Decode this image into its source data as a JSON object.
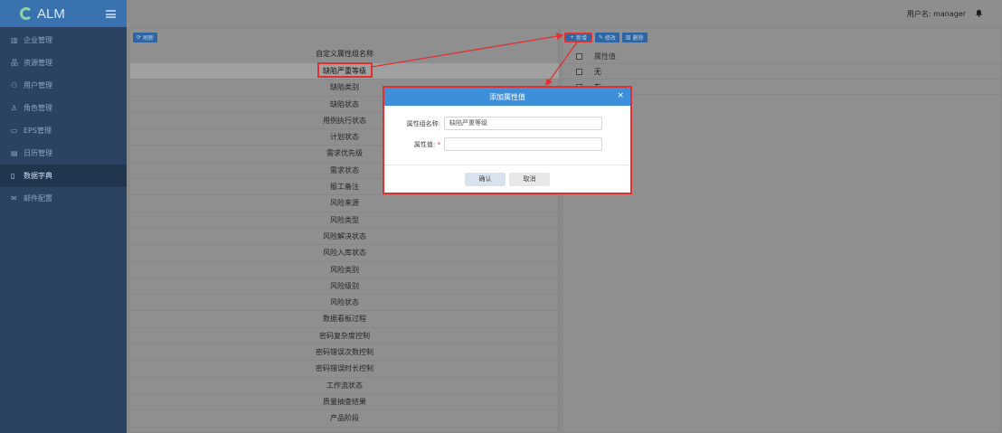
{
  "brand": {
    "logo_text": "ALM"
  },
  "sidebar": {
    "items": [
      {
        "label": "企业管理",
        "icon": "building-icon"
      },
      {
        "label": "资源管理",
        "icon": "sitemap-icon"
      },
      {
        "label": "用户管理",
        "icon": "users-icon"
      },
      {
        "label": "角色管理",
        "icon": "role-icon"
      },
      {
        "label": "EPS管理",
        "icon": "folder-icon"
      },
      {
        "label": "日历管理",
        "icon": "calendar-icon"
      },
      {
        "label": "数据字典",
        "icon": "book-icon",
        "active": true
      },
      {
        "label": "邮件配置",
        "icon": "mail-icon"
      }
    ]
  },
  "topbar": {
    "user_label": "用户名: manager"
  },
  "left_panel": {
    "refresh_label": "刷新",
    "column_header": "自定义属性组名称",
    "groups": [
      "缺陷严重等级",
      "缺陷类别",
      "缺陷状态",
      "用例执行状态",
      "计划状态",
      "需求优先级",
      "需求状态",
      "报工备注",
      "风险来源",
      "风险类型",
      "风险解决状态",
      "风险入库状态",
      "风险类别",
      "风险级别",
      "风险状态",
      "数据看板过程",
      "密码复杂度控制",
      "密码错误次数控制",
      "密码错误时长控制",
      "工作流状态",
      "质量抽查结果",
      "产品阶段"
    ],
    "selected_index": 0
  },
  "right_panel": {
    "toolbar": {
      "add_label": "新增",
      "edit_label": "修改",
      "delete_label": "删除"
    },
    "column_header": "属性值",
    "rows": [
      "无",
      "有"
    ]
  },
  "modal": {
    "title": "添加属性值",
    "group_name_label": "属性组名称:",
    "group_name_value": "缺陷严重等级",
    "value_label": "属性值:",
    "value_required_mark": "*",
    "value_current": "",
    "confirm_label": "确认",
    "cancel_label": "取消"
  },
  "colors": {
    "highlight": "#e23030",
    "modal_header": "#3d8fd9",
    "sidebar": "#2c4262"
  }
}
